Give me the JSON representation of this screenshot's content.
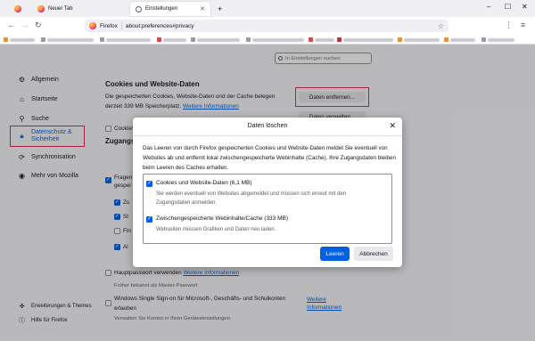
{
  "tabs": [
    {
      "label": "Neuer Tab"
    },
    {
      "label": "Einstellungen"
    }
  ],
  "new_tab_label": "+",
  "window": {
    "minimize": "–",
    "maximize": "☐",
    "close": "✕"
  },
  "nav": {
    "back": "←",
    "forward": "→",
    "reload": "↻",
    "url_badge": "Firefox",
    "url": "about:preferences#privacy",
    "extensions": "⋮",
    "menu": "≡"
  },
  "settings_search": {
    "placeholder": "In Einstellungen suchen"
  },
  "sidebar": {
    "items": [
      {
        "label": "Allgemein"
      },
      {
        "label": "Startseite"
      },
      {
        "label": "Suche"
      },
      {
        "label": "Datenschutz &",
        "label2": "Sicherheit"
      },
      {
        "label": "Synchronisation"
      },
      {
        "label": "Mehr von Mozilla"
      }
    ],
    "footer": [
      {
        "label": "Erweiterungen & Themes"
      },
      {
        "label": "Hilfe für Firefox"
      }
    ]
  },
  "cookies_section": {
    "title": "Cookies und Website-Daten",
    "line1": "Die gespeicherten Cookies, Website-Daten und der Cache belegen",
    "line2": "derzeit 339 MB Speicherplatz.",
    "more_info": "Weitere Informationen",
    "clear_button": "Daten entfernen...",
    "manage_button": "Daten verwalten...",
    "delete_on_close": "Cookies"
  },
  "passwords_section": {
    "title": "Zugangs",
    "ask_partial": "Fragen",
    "ask_partial2": "gespei",
    "auto_partial": "Zu",
    "suggest_partial": "St",
    "alert_partial": "Fin",
    "ask_partial3": "Al",
    "master_password": "Hauptpasswort verwenden",
    "master_password_info": "Weitere Informationen",
    "formerly": "Früher bekannt als Master-Passwort",
    "sso": "Windows Single Sign-on für Microsoft-, Geschäfts- und Schulkonten",
    "sso2": "erlauben",
    "sso_info1": "Weitere",
    "sso_info2": "Informationen",
    "sso_note": "Verwalten Sie Konten in Ihren Geräteeinstellungen."
  },
  "dialog": {
    "title": "Daten löschen",
    "close": "✕",
    "description": "Das Leeren von durch Firefox gespeicherten Cookies und Website-Daten meldet Sie eventuell von Websites ab und entfernt lokal zwischengespeicherte Webinhalte (Cache). Ihre Zugangsdaten bleiben beim Leeren des Caches erhalten.",
    "options": [
      {
        "label": "Cookies und Website-Daten (6,1 MB)",
        "sub": "Sie werden eventuell von Websites abgemeldet und müssen sich erneut mit den Zugangsdaten anmelden.",
        "checked": true
      },
      {
        "label": "Zwischengespeicherte Webinhalte/Cache (333 MB)",
        "sub": "Webseiten müssen Grafiken und Daten neu laden.",
        "checked": true
      }
    ],
    "clear_button": "Leeren",
    "cancel_button": "Abbrechen"
  },
  "colors": {
    "accent": "#0061e0",
    "highlight": "#e22850"
  }
}
